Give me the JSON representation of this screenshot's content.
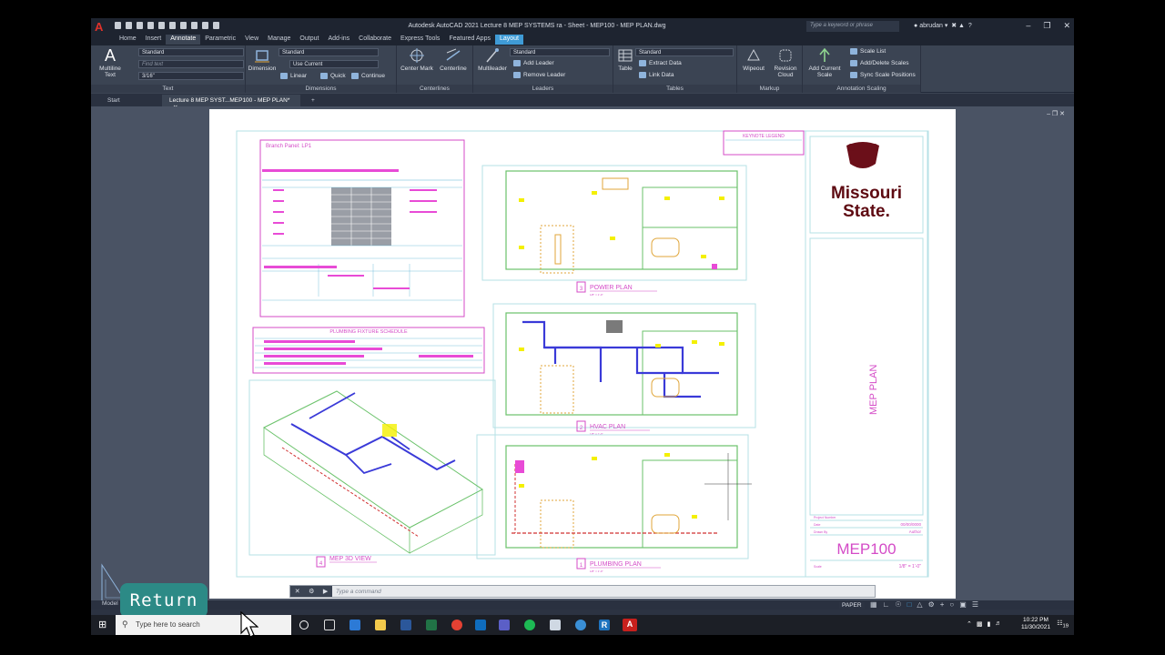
{
  "window": {
    "title": "Autodesk AutoCAD 2021   Lecture 8 MEP SYSTEMS ra - Sheet - MEP100 - MEP PLAN.dwg",
    "search_placeholder": "Type a keyword or phrase",
    "user": "abrudan"
  },
  "ribbon_tabs": [
    "Home",
    "Insert",
    "Annotate",
    "Parametric",
    "View",
    "Manage",
    "Output",
    "Add-ins",
    "Collaborate",
    "Express Tools",
    "Featured Apps",
    "Layout"
  ],
  "ribbon": {
    "text_panel": {
      "title": "Text",
      "multiline_label": "Multiline Text",
      "style": "Standard",
      "find_placeholder": "Find text",
      "height": "3/16\""
    },
    "dimensions_panel": {
      "title": "Dimensions",
      "dimension_label": "Dimension",
      "style": "Standard",
      "layer": "Use Current",
      "linear": "Linear",
      "quick": "Quick",
      "continue": "Continue"
    },
    "centerlines_panel": {
      "title": "Centerlines",
      "center_mark": "Center Mark",
      "centerline": "Centerline"
    },
    "leaders_panel": {
      "title": "Leaders",
      "multileader": "Multileader",
      "style": "Standard",
      "add_leader": "Add Leader",
      "remove_leader": "Remove Leader"
    },
    "tables_panel": {
      "title": "Tables",
      "table": "Table",
      "style": "Standard",
      "extract_data": "Extract Data",
      "link_data": "Link Data"
    },
    "markup_panel": {
      "title": "Markup",
      "wipeout": "Wipeout",
      "revision_cloud": "Revision Cloud"
    },
    "scaling_panel": {
      "title": "Annotation Scaling",
      "add_current_scale": "Add Current Scale",
      "scale_list": "Scale List",
      "add_delete_scales": "Add/Delete Scales",
      "sync_scale_positions": "Sync Scale Positions"
    }
  },
  "doc_tabs": [
    "Start",
    "Lecture 8 MEP SYST...MEP100 - MEP PLAN*"
  ],
  "sheet": {
    "branch_panel_title": "Branch Panel: LP1",
    "plumbing_schedule_title": "PLUMBING FIXTURE SCHEDULE",
    "keynote_legend": "KEYNOTE LEGEND",
    "logo_line1": "Missouri",
    "logo_line2": "State.",
    "sheet_name": "MEP PLAN",
    "sheet_number": "MEP100",
    "scale_value": "1/8\" = 1'-0\"",
    "views": [
      {
        "number": "3",
        "title": "POWER PLAN",
        "scale": "1/8\" = 1'-0\""
      },
      {
        "number": "2",
        "title": "HVAC PLAN",
        "scale": "1/8\" = 1'-0\""
      },
      {
        "number": "1",
        "title": "PLUMBING PLAN",
        "scale": "1/8\" = 1'-0\""
      },
      {
        "number": "4",
        "title": "MEP 3D VIEW",
        "scale": ""
      }
    ],
    "title_block_fields": {
      "project_number": "Project Number",
      "date_label": "Date",
      "date_value": "00/00/0000",
      "drawn_by_label": "Drawn By",
      "drawn_by_value": "Author",
      "scale_label": "Scale"
    }
  },
  "command_line": {
    "placeholder": "Type a command"
  },
  "layout_tab": "Model",
  "status": {
    "paper": "PAPER"
  },
  "overlay": {
    "return_label": "Return"
  },
  "taskbar": {
    "search_placeholder": "Type here to search",
    "time": "10:22 PM",
    "date": "11/30/2021",
    "notifications": "19"
  },
  "colors": {
    "accent": "#3f9bd6",
    "magenta": "#e02bd2",
    "return_button": "#2c8a86",
    "logo_maroon": "#5e0a12"
  }
}
